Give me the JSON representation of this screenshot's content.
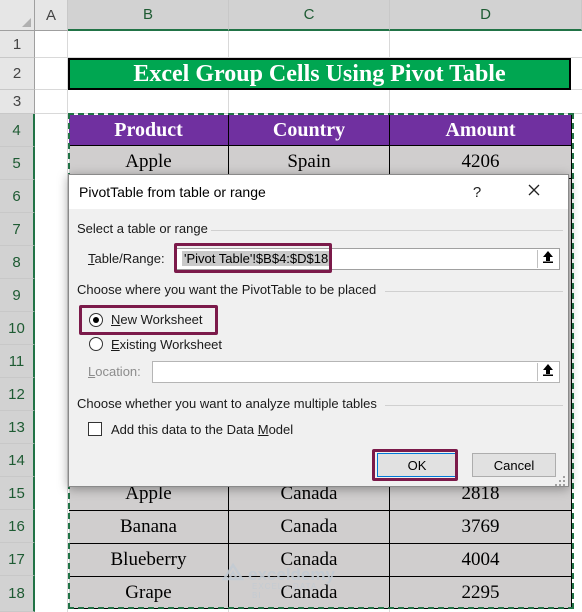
{
  "sheet": {
    "columns": [
      "A",
      "B",
      "C",
      "D"
    ],
    "rows": [
      "1",
      "2",
      "3",
      "4",
      "5",
      "6",
      "7",
      "8",
      "9",
      "10",
      "11",
      "12",
      "13",
      "14",
      "15",
      "16",
      "17",
      "18"
    ],
    "title": "Excel Group Cells Using Pivot Table",
    "table": {
      "headers": [
        "Product",
        "Country",
        "Amount"
      ],
      "rows": [
        [
          "Apple",
          "Spain",
          "4206"
        ],
        [
          "Apple",
          "Canada",
          "2818"
        ],
        [
          "Banana",
          "Canada",
          "3769"
        ],
        [
          "Blueberry",
          "Canada",
          "4004"
        ],
        [
          "Grape",
          "Canada",
          "2295"
        ]
      ]
    },
    "colors": {
      "title_bg": "#00a651",
      "header_bg": "#7030a0",
      "cell_bg": "#d0cece",
      "highlight": "#7b1a4a"
    }
  },
  "dialog": {
    "title": "PivotTable from table or range",
    "help_label": "?",
    "select_section": "Select a table or range",
    "table_range_label": "Table/Range:",
    "table_range_value": "'Pivot Table'!$B$4:$D$18",
    "place_section": "Choose where you want the PivotTable to be placed",
    "new_worksheet": "New Worksheet",
    "existing_worksheet": "Existing Worksheet",
    "location_label": "Location:",
    "location_value": "",
    "multiple_section": "Choose whether you want to analyze multiple tables",
    "data_model_label": "Add this data to the Data Model",
    "ok_label": "OK",
    "cancel_label": "Cancel",
    "selected_option": "New Worksheet",
    "data_model_checked": false
  },
  "watermark": {
    "brand": "exceldemy",
    "tagline": "EXCEL · DATA · BI"
  },
  "icons": [
    "collapse-dialog-icon",
    "close-icon",
    "resize-grip-icon",
    "exceldemy-logo-icon"
  ]
}
